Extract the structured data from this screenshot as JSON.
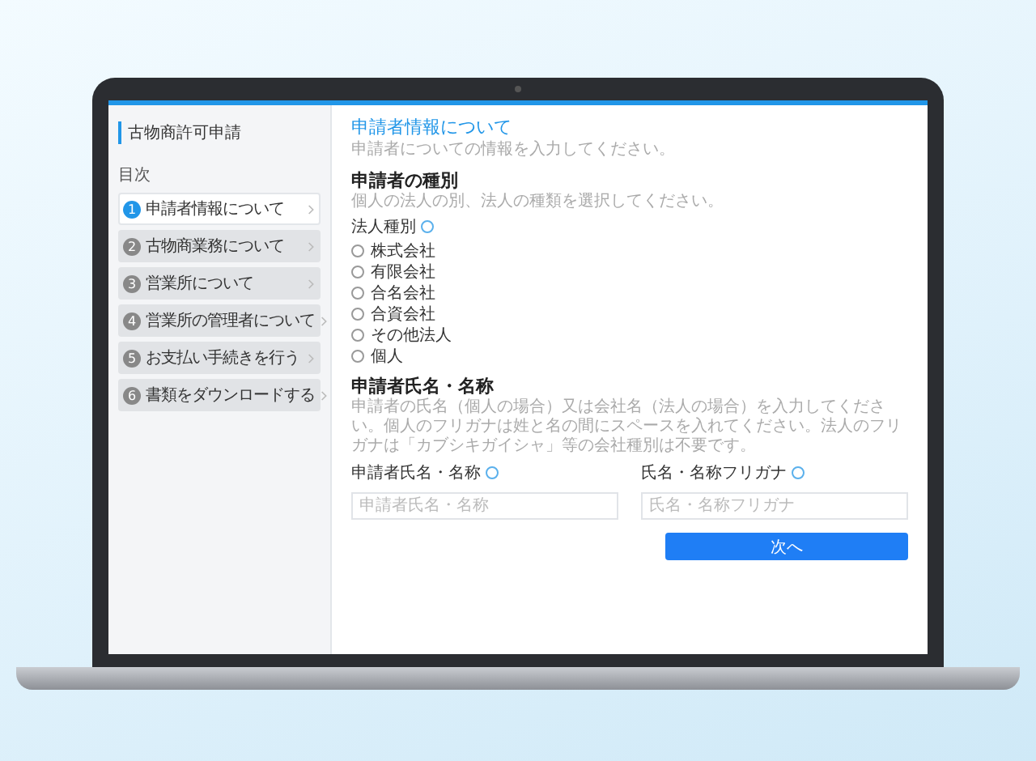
{
  "sidebar": {
    "title": "古物商許可申請",
    "toc_label": "目次",
    "steps": [
      {
        "number": "1",
        "label": "申請者情報について",
        "selected": true
      },
      {
        "number": "2",
        "label": "古物商業務について",
        "selected": false
      },
      {
        "number": "3",
        "label": "営業所について",
        "selected": false
      },
      {
        "number": "4",
        "label": "営業所の管理者について",
        "selected": false
      },
      {
        "number": "5",
        "label": "お支払い手続きを行う",
        "selected": false
      },
      {
        "number": "6",
        "label": "書類をダウンロードする",
        "selected": false
      }
    ]
  },
  "main": {
    "title": "申請者情報について",
    "description": "申請者についての情報を入力してください。",
    "type_section": {
      "heading": "申請者の種別",
      "description": "個人の法人の別、法人の種類を選択してください。",
      "field_label": "法人種別",
      "options": [
        {
          "label": "株式会社",
          "selected": false
        },
        {
          "label": "有限会社",
          "selected": false
        },
        {
          "label": "合名会社",
          "selected": false
        },
        {
          "label": "合資会社",
          "selected": false
        },
        {
          "label": "その他法人",
          "selected": false
        },
        {
          "label": "個人",
          "selected": false
        }
      ]
    },
    "name_section": {
      "heading": "申請者氏名・名称",
      "description": "申請者の氏名（個人の場合）又は会社名（法人の場合）を入力してください。個人のフリガナは姓と名の間にスペースを入れてください。法人のフリガナは「カブシキガイシャ」等の会社種別は不要です。",
      "fields": [
        {
          "label": "申請者氏名・名称",
          "placeholder": "申請者氏名・名称"
        },
        {
          "label": "氏名・名称フリガナ",
          "placeholder": "氏名・名称フリガナ"
        }
      ]
    },
    "next_button": "次へ"
  }
}
